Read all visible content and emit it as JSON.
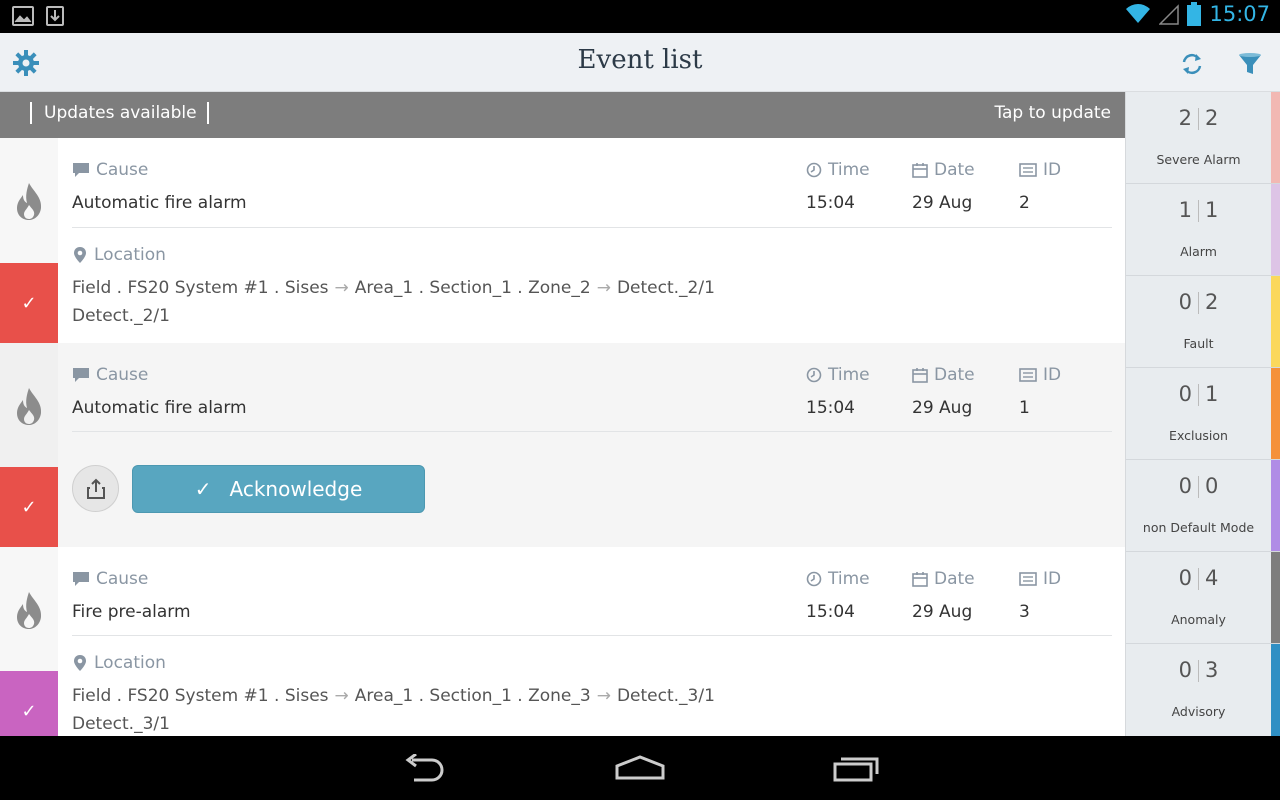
{
  "status_bar": {
    "time": "15:07",
    "accent": "#33b5e5"
  },
  "app_bar": {
    "title": "Event list",
    "icons": [
      "gear-icon",
      "refresh-icon",
      "filter-icon"
    ]
  },
  "update_bar": {
    "left_text": "Updates available",
    "right_text": "Tap to update"
  },
  "events": [
    {
      "cause_label": "Cause",
      "cause": "Automatic fire alarm",
      "time_label": "Time",
      "time": "15:04",
      "date_label": "Date",
      "date": "29 Aug",
      "id_label": "ID",
      "id": "2",
      "location_label": "Location",
      "location": {
        "part1": "Field . FS20 System #1 . Sises",
        "part2": "Area_1 . Section_1 . Zone_2",
        "part3": "Detect._2/1",
        "line2": "Detect._2/1"
      },
      "status_color": "#e8504a",
      "check": "✓"
    },
    {
      "cause_label": "Cause",
      "cause": "Automatic fire alarm",
      "time_label": "Time",
      "time": "15:04",
      "date_label": "Date",
      "date": "29 Aug",
      "id_label": "ID",
      "id": "1",
      "acknowledge_label": "Acknowledge",
      "status_color": "#e8504a",
      "check": "✓"
    },
    {
      "cause_label": "Cause",
      "cause": "Fire pre-alarm",
      "time_label": "Time",
      "time": "15:04",
      "date_label": "Date",
      "date": "29 Aug",
      "id_label": "ID",
      "id": "3",
      "location_label": "Location",
      "location": {
        "part1": "Field . FS20 System #1 . Sises",
        "part2": "Area_1 . Section_1 . Zone_3",
        "part3": "Detect._3/1",
        "line2": "Detect._3/1"
      },
      "status_color": "#c964c1",
      "check": "✓"
    }
  ],
  "categories": [
    {
      "a": "2",
      "b": "2",
      "label": "Severe Alarm",
      "color": "#f2b8b3"
    },
    {
      "a": "1",
      "b": "1",
      "label": "Alarm",
      "color": "#ddc4e6"
    },
    {
      "a": "0",
      "b": "2",
      "label": "Fault",
      "color": "#fbd85c"
    },
    {
      "a": "0",
      "b": "1",
      "label": "Exclusion",
      "color": "#f5913a"
    },
    {
      "a": "0",
      "b": "0",
      "label": "non Default Mode",
      "color": "#b08ce6"
    },
    {
      "a": "0",
      "b": "4",
      "label": "Anomaly",
      "color": "#7d7d7d"
    },
    {
      "a": "0",
      "b": "3",
      "label": "Advisory",
      "color": "#2f8fc4"
    }
  ]
}
